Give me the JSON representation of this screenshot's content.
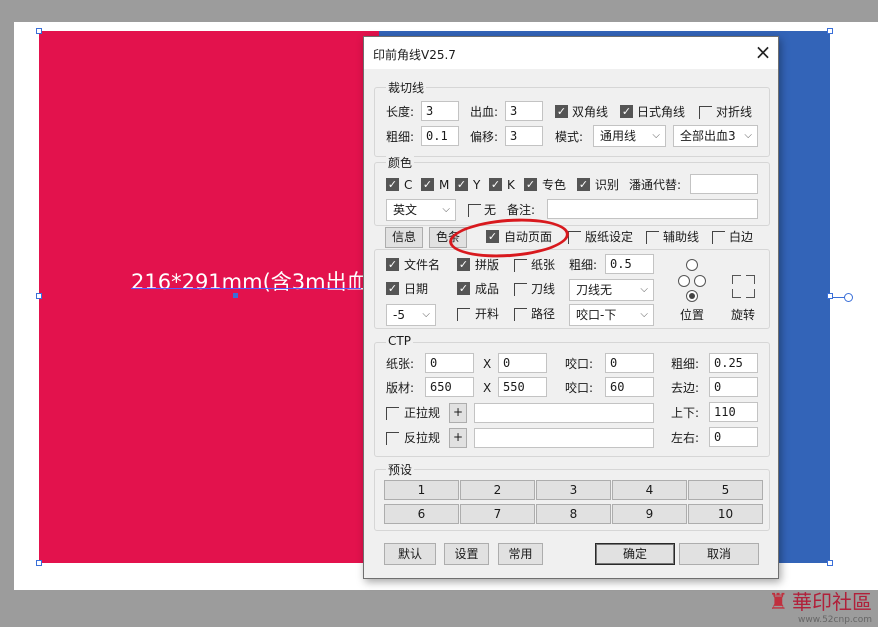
{
  "artboard": {
    "dimension_text": "216*291mm(含3m出血",
    "colors": {
      "red_page": "#e3124d",
      "blue_page": "#3364b8",
      "background": "#9c9c9c"
    }
  },
  "dialog": {
    "title": "印前角线V25.7",
    "close_icon": "×",
    "cut_line": {
      "group_title": "裁切线",
      "length_label": "长度:",
      "length_value": "3",
      "bleed_label": "出血:",
      "bleed_value": "3",
      "double_corner_label": "双角线",
      "double_corner_checked": true,
      "japanese_corner_label": "日式角线",
      "japanese_corner_checked": true,
      "fold_line_label": "对折线",
      "fold_line_checked": false,
      "thickness_label": "粗细:",
      "thickness_value": "0.1",
      "offset_label": "偏移:",
      "offset_value": "3",
      "mode_label": "模式:",
      "mode_value": "通用线",
      "bleed_mode_value": "全部出血3"
    },
    "color": {
      "group_title": "颜色",
      "c_label": "C",
      "m_label": "M",
      "y_label": "Y",
      "k_label": "K",
      "spot_label": "专色",
      "identify_label": "识别",
      "substitute_label": "潘通代替:",
      "substitute_value": "",
      "language_value": "英文",
      "none_label": "无",
      "none_checked": false,
      "note_label": "备注:",
      "note_value": ""
    },
    "tabs": {
      "info": "信息",
      "color_bar": "色条",
      "auto_page_label": "自动页面",
      "auto_page_checked": true,
      "sheet_setting_label": "版纸设定",
      "guide_line_label": "辅助线",
      "white_edge_label": "白边"
    },
    "info": {
      "filename_label": "文件名",
      "splice_label": "拼版",
      "paper_label": "纸张",
      "thickness_label": "粗细:",
      "thickness_value": "0.5",
      "date_label": "日期",
      "finished_label": "成品",
      "knife_label": "刀线",
      "knife_select": "刀线无",
      "offset_select": "-5",
      "open_label": "开料",
      "path_label": "路径",
      "bite_select": "咬口-下",
      "position_label": "位置",
      "rotate_label": "旋转"
    },
    "ctp": {
      "group_title": "CTP",
      "paper_label": "纸张:",
      "paper_value": "0",
      "x1_label": "X",
      "x1_value": "0",
      "bite1_label": "咬口:",
      "bite1_value": "0",
      "thickness_label": "粗细:",
      "thickness_value": "0.25",
      "plate_label": "版材:",
      "plate_value": "650",
      "x2_label": "X",
      "x2_value": "550",
      "bite2_label": "咬口:",
      "bite2_value": "60",
      "trim_label": "去边:",
      "trim_value": "0",
      "front_pull_label": "正拉规",
      "front_pull_value": "",
      "updown_label": "上下:",
      "updown_value": "110",
      "back_pull_label": "反拉规",
      "back_pull_value": "",
      "leftright_label": "左右:",
      "leftright_value": "0",
      "plus": "+"
    },
    "presets": {
      "group_title": "预设",
      "items": [
        "1",
        "2",
        "3",
        "4",
        "5",
        "6",
        "7",
        "8",
        "9",
        "10"
      ]
    },
    "footer": {
      "default": "默认",
      "settings": "设置",
      "common": "常用",
      "ok": "确定",
      "cancel": "取消"
    }
  },
  "watermark": {
    "logo": "華印社區",
    "url": "www.52cnp.com"
  }
}
